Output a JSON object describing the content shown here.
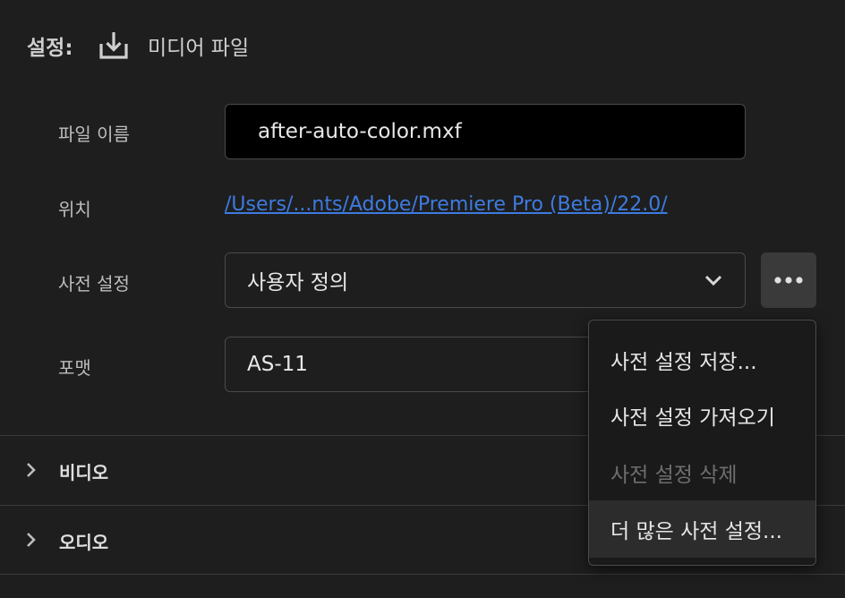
{
  "header": {
    "settings_label": "설정:",
    "export_title": "미디어 파일"
  },
  "form": {
    "filename_label": "파일 이름",
    "filename_value": "after-auto-color.mxf",
    "location_label": "위치",
    "location_value": "/Users/...nts/Adobe/Premiere Pro (Beta)/22.0/",
    "preset_label": "사전 설정",
    "preset_value": "사용자 정의",
    "format_label": "포맷",
    "format_value": "AS-11"
  },
  "sections": {
    "video": "비디오",
    "audio": "오디오"
  },
  "menu": {
    "items": [
      {
        "label": "사전 설정 저장...",
        "enabled": true
      },
      {
        "label": "사전 설정 가져오기",
        "enabled": true
      },
      {
        "label": "사전 설정 삭제",
        "enabled": false
      },
      {
        "label": "더 많은 사전 설정...",
        "enabled": true
      }
    ]
  },
  "icons": {
    "export": "download-icon",
    "preset_dropdown": "chevron-down-icon",
    "more": "more-horizontal-icon",
    "section_expand": "chevron-right-icon"
  },
  "colors": {
    "background": "#1e1e1e",
    "link": "#3d7be0",
    "field_border": "#4a4a4a",
    "menu_highlight": "#2c2c2c"
  }
}
